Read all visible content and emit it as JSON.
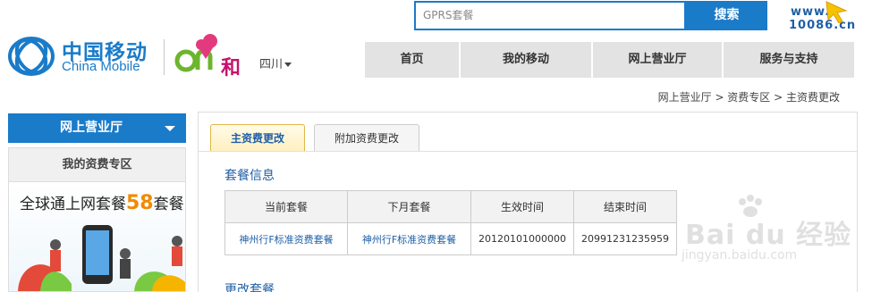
{
  "search": {
    "placeholder": "GPRS套餐",
    "value": "GPRS套餐",
    "button_label": "搜索"
  },
  "brand": {
    "site_www": "www.",
    "site_num": "10086.cn",
    "name_zh": "中国移动",
    "name_en": "China Mobile",
    "and_he": "和",
    "region": "四川"
  },
  "nav": {
    "items": [
      "首页",
      "我的移动",
      "网上营业厅",
      "服务与支持"
    ]
  },
  "breadcrumb": "网上营业厅 > 资费专区 > 主资费更改",
  "sidebar": {
    "header": "网上营业厅",
    "sub_title": "我的资费专区",
    "banner_prefix": "全球通上网套餐",
    "banner_number": "58",
    "banner_suffix": "套餐"
  },
  "main": {
    "tabs": [
      "主资费更改",
      "附加资费更改"
    ],
    "active_tab": 0,
    "package_section": "套餐信息",
    "change_section": "更改套餐",
    "table": {
      "headers": [
        "当前套餐",
        "下月套餐",
        "生效时间",
        "结束时间"
      ],
      "rows": [
        [
          "神州行F标准资费套餐",
          "神州行F标准资费套餐",
          "20120101000000",
          "20991231235959"
        ]
      ]
    }
  },
  "watermark": {
    "text": "Bai du 经验",
    "sub": "jingyan.baidu.com"
  },
  "colors": {
    "accent": "#1a7bc9",
    "link": "#1f5fa6",
    "brand_pink": "#c5126c",
    "highlight": "#f08a00"
  }
}
